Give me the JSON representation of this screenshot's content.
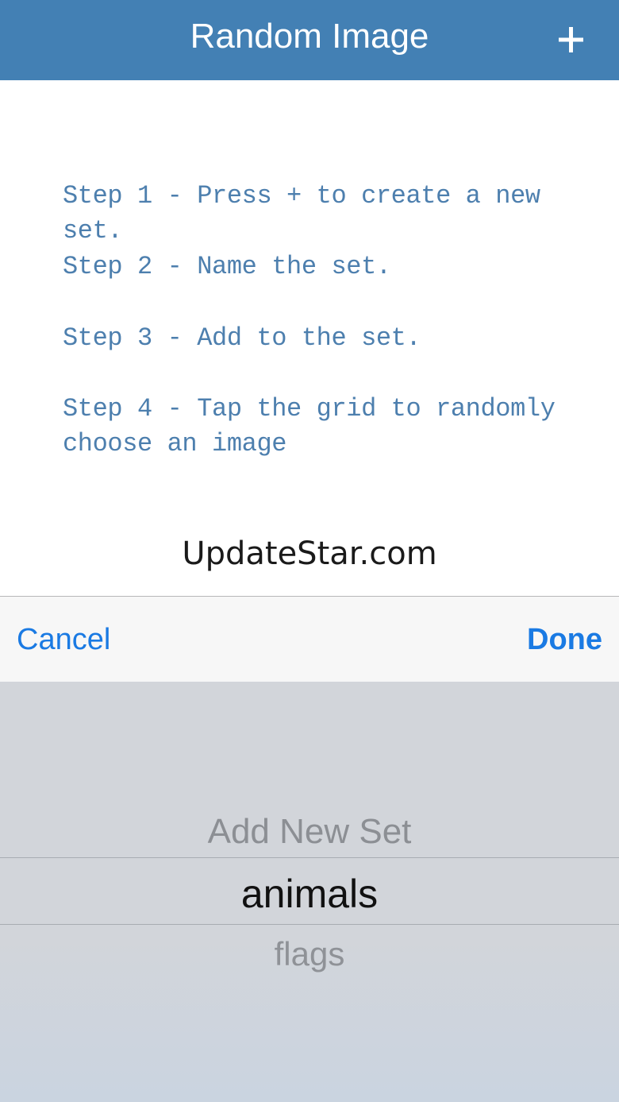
{
  "navbar": {
    "title": "Random Image",
    "add_icon": "plus-icon",
    "background_color": "#4380b4"
  },
  "instructions": {
    "steps": [
      "Step 1 - Press + to create a new set.",
      "Step 2 - Name the set.",
      "Step 3 - Add to the set.",
      "Step 4 - Tap the grid to randomly\nchoose an image"
    ],
    "text_color": "#4d7fae"
  },
  "watermark": "UpdateStar.com",
  "picker_toolbar": {
    "cancel_label": "Cancel",
    "done_label": "Done",
    "accent_color": "#1a7ae3"
  },
  "picker": {
    "options": [
      "Add New Set",
      "animals",
      "flags"
    ],
    "selected": "animals"
  }
}
